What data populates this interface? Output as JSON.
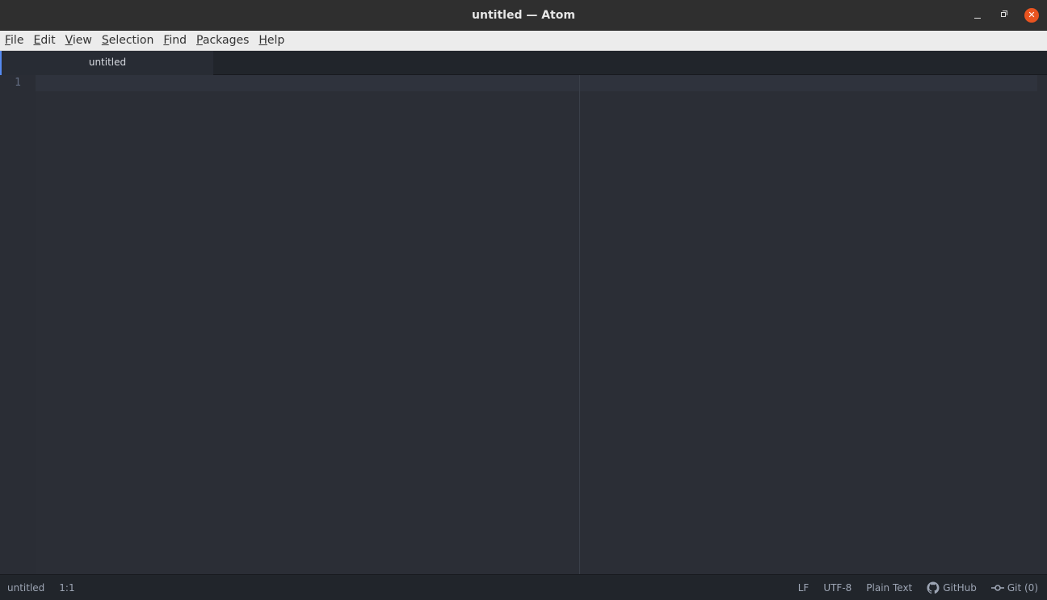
{
  "window": {
    "title": "untitled — Atom"
  },
  "menubar": {
    "items": [
      {
        "mnemonic": "F",
        "rest": "ile"
      },
      {
        "mnemonic": "E",
        "rest": "dit"
      },
      {
        "mnemonic": "V",
        "rest": "iew"
      },
      {
        "mnemonic": "S",
        "rest": "election"
      },
      {
        "mnemonic": "F",
        "rest": "ind"
      },
      {
        "mnemonic": "P",
        "rest": "ackages"
      },
      {
        "mnemonic": "H",
        "rest": "elp"
      }
    ]
  },
  "tabs": [
    {
      "label": "untitled",
      "active": true
    }
  ],
  "editor": {
    "line_numbers": [
      "1"
    ]
  },
  "statusbar": {
    "file": "untitled",
    "cursor_position": "1:1",
    "line_ending": "LF",
    "encoding": "UTF-8",
    "grammar": "Plain Text",
    "github_label": "GitHub",
    "git_label": "Git (0)"
  },
  "colors": {
    "accent": "#568af2",
    "close_button": "#e95420"
  },
  "icons": {
    "github": "github-icon",
    "git": "git-commit-icon"
  }
}
